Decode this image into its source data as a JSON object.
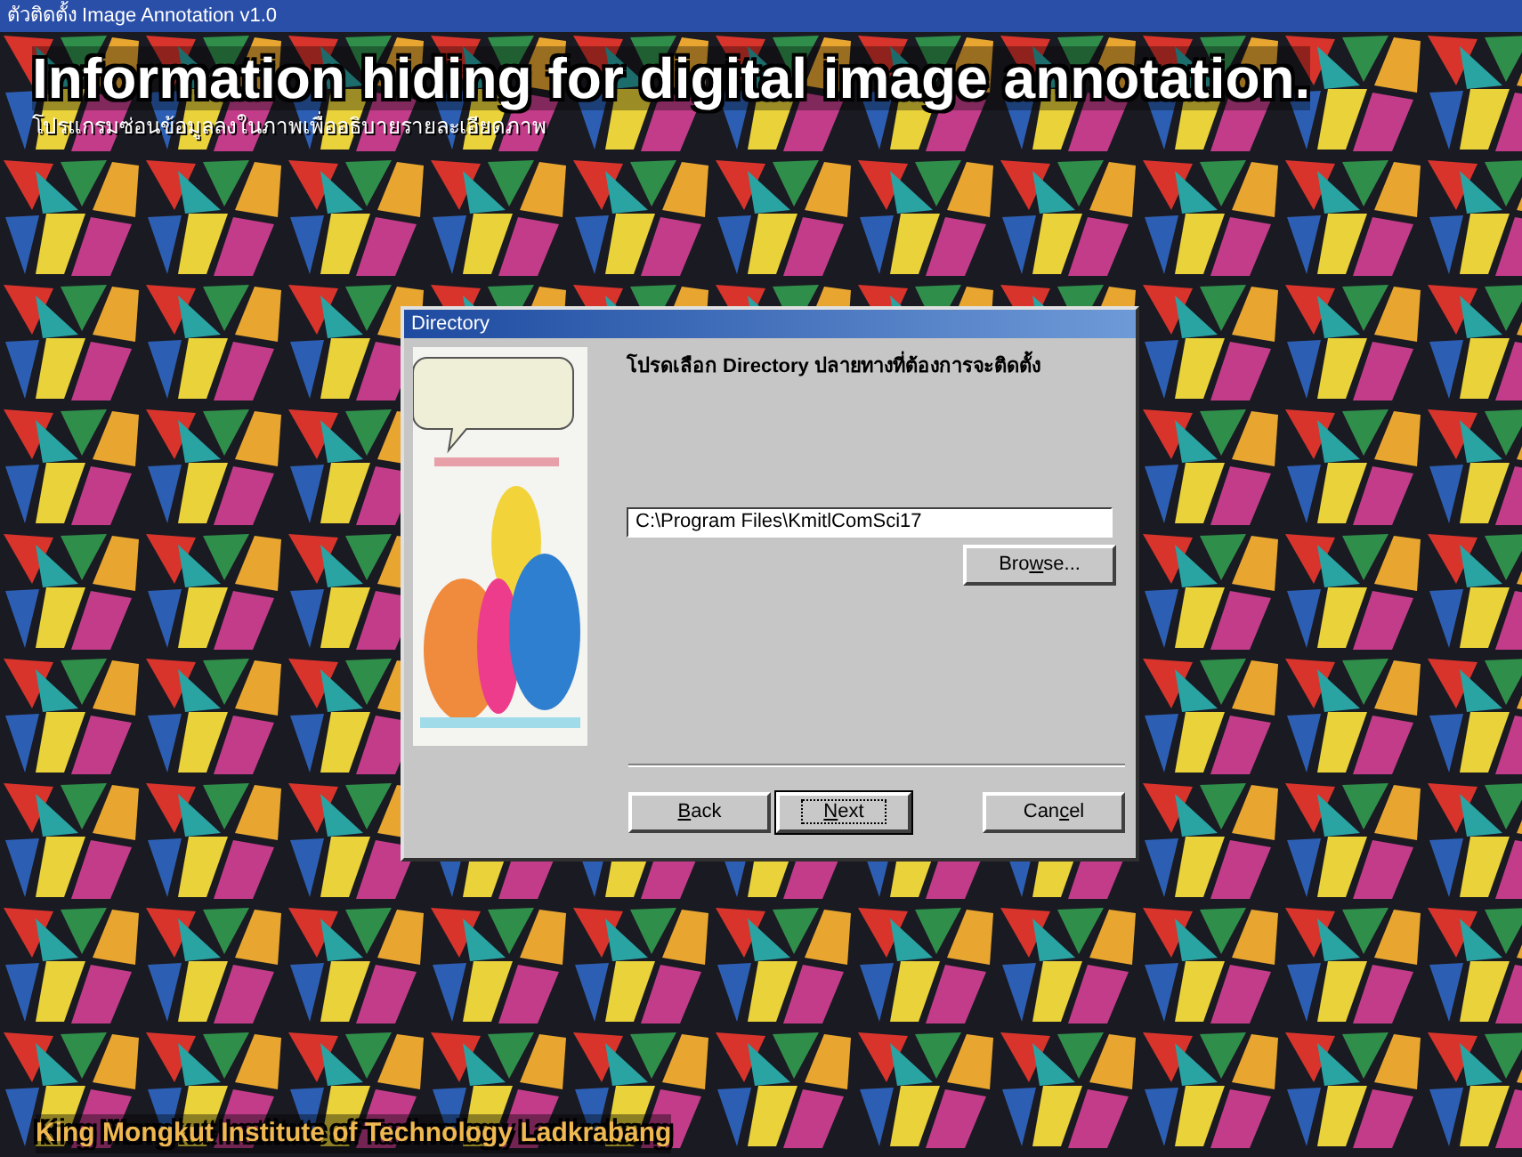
{
  "window": {
    "title": "ตัวติดตั้ง Image Annotation v1.0"
  },
  "heading": "Information hiding for digital image annotation.",
  "subheading": "โปรแกรมซ่อนข้อมูลลงในภาพเพื่ออธิบายรายละเอียดภาพ",
  "dialog": {
    "title": "Directory",
    "instruction": "โปรดเลือก Directory ปลายทางที่ต้องการจะติดตั้ง",
    "path_field": {
      "value": "C:\\Program Files\\KmitlComSci17"
    },
    "browse_button": {
      "label_before": "Bro",
      "access_key": "w",
      "label_after": "se..."
    },
    "buttons": [
      {
        "access_key": "B",
        "label_after": "ack",
        "default": false
      },
      {
        "access_key": "N",
        "label_after": "ext",
        "default": true
      },
      {
        "label_before": "Can",
        "access_key": "c",
        "label_after": "el",
        "default": false
      }
    ]
  },
  "footer": "King Mongkut Institute of Technology Ladkrabang"
}
